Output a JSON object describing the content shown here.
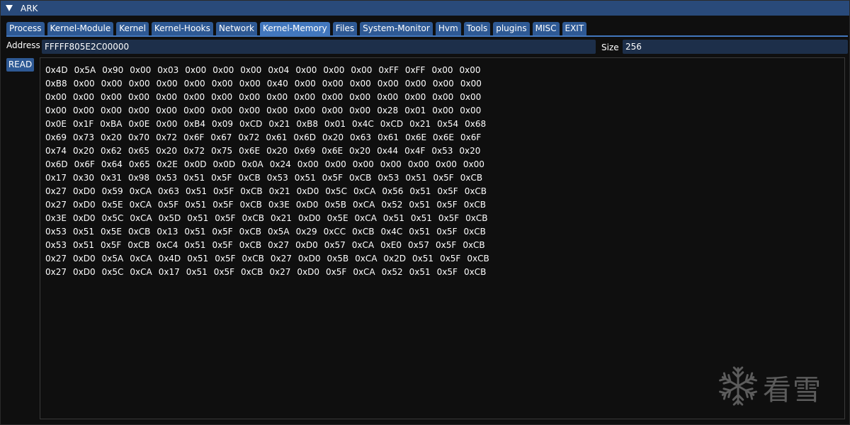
{
  "window": {
    "title": "ARK"
  },
  "tabs": [
    {
      "label": "Process",
      "active": false
    },
    {
      "label": "Kernel-Module",
      "active": false
    },
    {
      "label": "Kernel",
      "active": false
    },
    {
      "label": "Kernel-Hooks",
      "active": false
    },
    {
      "label": "Network",
      "active": false
    },
    {
      "label": "Kernel-Memory",
      "active": true
    },
    {
      "label": "Files",
      "active": false
    },
    {
      "label": "System-Monitor",
      "active": false
    },
    {
      "label": "Hvm",
      "active": false
    },
    {
      "label": "Tools",
      "active": false
    },
    {
      "label": "plugins",
      "active": false
    },
    {
      "label": "MISC",
      "active": false
    },
    {
      "label": "EXIT",
      "active": false
    }
  ],
  "address": {
    "label": "Address",
    "value": "FFFFF805E2C00000"
  },
  "size": {
    "label": "Size",
    "value": "256"
  },
  "read_button": {
    "label": "READ"
  },
  "hex_rows": [
    [
      "0x4D",
      "0x5A",
      "0x90",
      "0x00",
      "0x03",
      "0x00",
      "0x00",
      "0x00",
      "0x04",
      "0x00",
      "0x00",
      "0x00",
      "0xFF",
      "0xFF",
      "0x00",
      "0x00"
    ],
    [
      "0xB8",
      "0x00",
      "0x00",
      "0x00",
      "0x00",
      "0x00",
      "0x00",
      "0x00",
      "0x40",
      "0x00",
      "0x00",
      "0x00",
      "0x00",
      "0x00",
      "0x00",
      "0x00"
    ],
    [
      "0x00",
      "0x00",
      "0x00",
      "0x00",
      "0x00",
      "0x00",
      "0x00",
      "0x00",
      "0x00",
      "0x00",
      "0x00",
      "0x00",
      "0x00",
      "0x00",
      "0x00",
      "0x00"
    ],
    [
      "0x00",
      "0x00",
      "0x00",
      "0x00",
      "0x00",
      "0x00",
      "0x00",
      "0x00",
      "0x00",
      "0x00",
      "0x00",
      "0x00",
      "0x28",
      "0x01",
      "0x00",
      "0x00"
    ],
    [
      "0x0E",
      "0x1F",
      "0xBA",
      "0x0E",
      "0x00",
      "0xB4",
      "0x09",
      "0xCD",
      "0x21",
      "0xB8",
      "0x01",
      "0x4C",
      "0xCD",
      "0x21",
      "0x54",
      "0x68"
    ],
    [
      "0x69",
      "0x73",
      "0x20",
      "0x70",
      "0x72",
      "0x6F",
      "0x67",
      "0x72",
      "0x61",
      "0x6D",
      "0x20",
      "0x63",
      "0x61",
      "0x6E",
      "0x6E",
      "0x6F"
    ],
    [
      "0x74",
      "0x20",
      "0x62",
      "0x65",
      "0x20",
      "0x72",
      "0x75",
      "0x6E",
      "0x20",
      "0x69",
      "0x6E",
      "0x20",
      "0x44",
      "0x4F",
      "0x53",
      "0x20"
    ],
    [
      "0x6D",
      "0x6F",
      "0x64",
      "0x65",
      "0x2E",
      "0x0D",
      "0x0D",
      "0x0A",
      "0x24",
      "0x00",
      "0x00",
      "0x00",
      "0x00",
      "0x00",
      "0x00",
      "0x00"
    ],
    [
      "0x17",
      "0x30",
      "0x31",
      "0x98",
      "0x53",
      "0x51",
      "0x5F",
      "0xCB",
      "0x53",
      "0x51",
      "0x5F",
      "0xCB",
      "0x53",
      "0x51",
      "0x5F",
      "0xCB"
    ],
    [
      "0x27",
      "0xD0",
      "0x59",
      "0xCA",
      "0x63",
      "0x51",
      "0x5F",
      "0xCB",
      "0x21",
      "0xD0",
      "0x5C",
      "0xCA",
      "0x56",
      "0x51",
      "0x5F",
      "0xCB"
    ],
    [
      "0x27",
      "0xD0",
      "0x5E",
      "0xCA",
      "0x5F",
      "0x51",
      "0x5F",
      "0xCB",
      "0x3E",
      "0xD0",
      "0x5B",
      "0xCA",
      "0x52",
      "0x51",
      "0x5F",
      "0xCB"
    ],
    [
      "0x3E",
      "0xD0",
      "0x5C",
      "0xCA",
      "0x5D",
      "0x51",
      "0x5F",
      "0xCB",
      "0x21",
      "0xD0",
      "0x5E",
      "0xCA",
      "0x51",
      "0x51",
      "0x5F",
      "0xCB"
    ],
    [
      "0x53",
      "0x51",
      "0x5E",
      "0xCB",
      "0x13",
      "0x51",
      "0x5F",
      "0xCB",
      "0x5A",
      "0x29",
      "0xCC",
      "0xCB",
      "0x4C",
      "0x51",
      "0x5F",
      "0xCB"
    ],
    [
      "0x53",
      "0x51",
      "0x5F",
      "0xCB",
      "0xC4",
      "0x51",
      "0x5F",
      "0xCB",
      "0x27",
      "0xD0",
      "0x57",
      "0xCA",
      "0xE0",
      "0x57",
      "0x5F",
      "0xCB"
    ],
    [
      "0x27",
      "0xD0",
      "0x5A",
      "0xCA",
      "0x4D",
      "0x51",
      "0x5F",
      "0xCB",
      "0x27",
      "0xD0",
      "0x5B",
      "0xCA",
      "0x2D",
      "0x51",
      "0x5F",
      "0xCB"
    ],
    [
      "0x27",
      "0xD0",
      "0x5C",
      "0xCA",
      "0x17",
      "0x51",
      "0x5F",
      "0xCB",
      "0x27",
      "0xD0",
      "0x5F",
      "0xCA",
      "0x52",
      "0x51",
      "0x5F",
      "0xCB"
    ]
  ],
  "watermark": {
    "icon": "snowflake-icon",
    "text": "看雪"
  },
  "colors": {
    "titlebar": "#294a7a",
    "tab": "#2e5994",
    "tab_active": "#4277bd",
    "field_bg": "#1d2f4a",
    "background": "#0f0f0f"
  }
}
